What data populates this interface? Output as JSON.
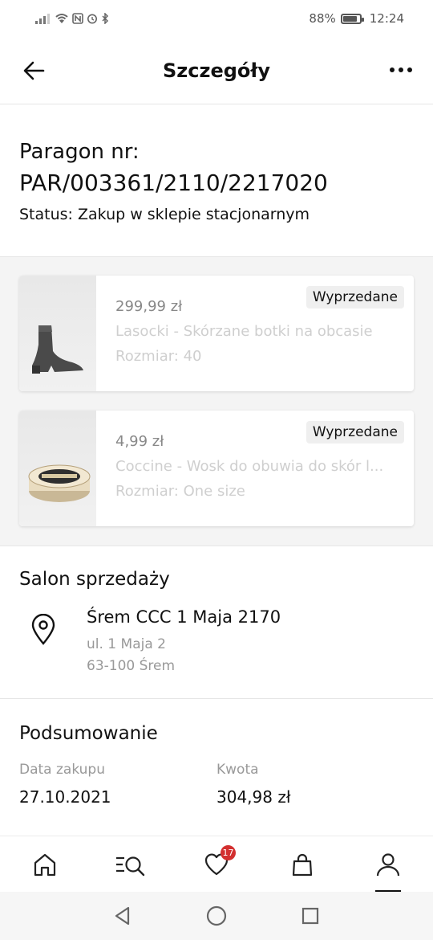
{
  "status_bar": {
    "battery": "88%",
    "time": "12:24"
  },
  "header": {
    "title": "Szczegóły"
  },
  "receipt": {
    "label": "Paragon nr:",
    "number": "PAR/003361/2110/2217020",
    "status": "Status: Zakup w sklepie stacjonarnym"
  },
  "products": [
    {
      "price": "299,99 zł",
      "name": "Lasocki - Skórzane botki na obcasie",
      "size": "Rozmiar: 40",
      "badge": "Wyprzedane",
      "thumb_icon": "ankle-boot-image"
    },
    {
      "price": "4,99 zł",
      "name": "Coccine - Wosk do obuwia do skór l...",
      "size": "Rozmiar: One size",
      "badge": "Wyprzedane",
      "thumb_icon": "shoe-wax-tin-image"
    }
  ],
  "store": {
    "section_title": "Salon sprzedaży",
    "name": "Śrem CCC 1 Maja 2170",
    "address_line1": "ul. 1 Maja 2",
    "address_line2": "63-100 Śrem"
  },
  "summary": {
    "section_title": "Podsumowanie",
    "date_label": "Data zakupu",
    "date_value": "27.10.2021",
    "amount_label": "Kwota",
    "amount_value": "304,98 zł"
  },
  "bottom_nav": {
    "items": [
      "home-icon",
      "search-list-icon",
      "heart-icon",
      "bag-icon",
      "profile-icon"
    ],
    "favorites_count": "17",
    "active": "profile-icon"
  },
  "system_nav": [
    "back-triangle-icon",
    "home-circle-icon",
    "recents-square-icon"
  ]
}
